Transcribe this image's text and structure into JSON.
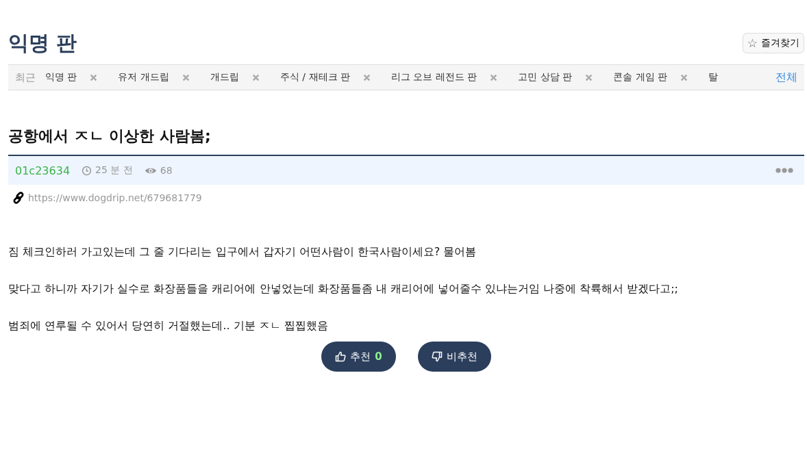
{
  "board_title": "익명 판",
  "favorite_button": {
    "icon": "☆",
    "label": "즐겨찾기"
  },
  "recent": {
    "label": "최근",
    "items": [
      {
        "label": "익명 판"
      },
      {
        "label": "유저 개드립"
      },
      {
        "label": "개드립"
      },
      {
        "label": "주식 / 재테크 판"
      },
      {
        "label": "리그 오브 레전드 판"
      },
      {
        "label": "고민 상담 판"
      },
      {
        "label": "콘솔 게임 판"
      },
      {
        "label": "탈",
        "cut": true
      }
    ],
    "all_link": "전체"
  },
  "post": {
    "title": "공항에서 ㅈㄴ 이상한 사람봄;",
    "author": "01c23634",
    "time": "25 분 전",
    "views": "68",
    "url": "https://www.dogdrip.net/679681779",
    "paragraphs": [
      "짐 체크인하러 가고있는데 그 줄 기다리는 입구에서 갑자기 어떤사람이 한국사람이세요? 물어봄",
      "맞다고 하니까 자기가 실수로 화장품들을 캐리어에 안넣었는데 화장품들좀 내 캐리어에 넣어줄수 있냐는거임 나중에 착륙해서 받겠다고;;",
      "범죄에 연루될 수 있어서 당연히 거절했는데.. 기분 ㅈㄴ 찝찝했음"
    ],
    "upvote": {
      "label": "추천",
      "count": "0"
    },
    "downvote": {
      "label": "비추천"
    }
  }
}
